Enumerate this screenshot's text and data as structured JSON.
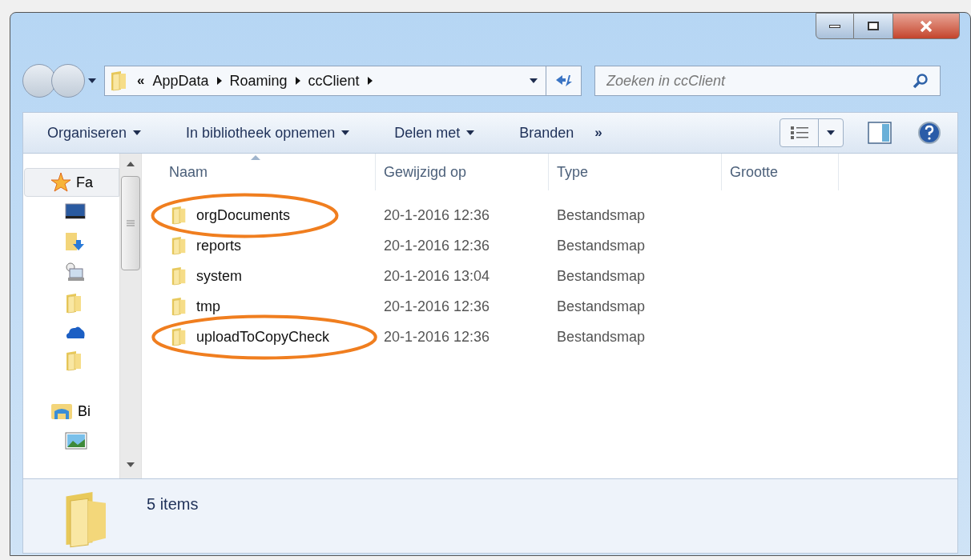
{
  "address": {
    "overflow": "«",
    "crumbs": [
      "AppData",
      "Roaming",
      "ccClient"
    ]
  },
  "search": {
    "placeholder": "Zoeken in ccClient"
  },
  "toolbar": {
    "items": [
      {
        "label": "Organiseren",
        "dropdown": true
      },
      {
        "label": "In bibliotheek opnemen",
        "dropdown": true
      },
      {
        "label": "Delen met",
        "dropdown": true
      },
      {
        "label": "Branden",
        "dropdown": false
      }
    ],
    "more": "»"
  },
  "sidebar": {
    "groups": [
      {
        "label": "Fa",
        "selected": true
      },
      {
        "label": "Bi",
        "selected": false
      }
    ]
  },
  "columns": [
    {
      "label": "Naam",
      "sorted": true
    },
    {
      "label": "Gewijzigd op",
      "sorted": false
    },
    {
      "label": "Type",
      "sorted": false
    },
    {
      "label": "Grootte",
      "sorted": false
    }
  ],
  "files": [
    {
      "name": "orgDocuments",
      "modified": "20-1-2016 12:36",
      "type": "Bestandsmap",
      "circled": true
    },
    {
      "name": "reports",
      "modified": "20-1-2016 12:36",
      "type": "Bestandsmap",
      "circled": false
    },
    {
      "name": "system",
      "modified": "20-1-2016 13:04",
      "type": "Bestandsmap",
      "circled": false
    },
    {
      "name": "tmp",
      "modified": "20-1-2016 12:36",
      "type": "Bestandsmap",
      "circled": false
    },
    {
      "name": "uploadToCopyCheck",
      "modified": "20-1-2016 12:36",
      "type": "Bestandsmap",
      "circled": true
    }
  ],
  "status_bar": {
    "count": "5 items"
  }
}
